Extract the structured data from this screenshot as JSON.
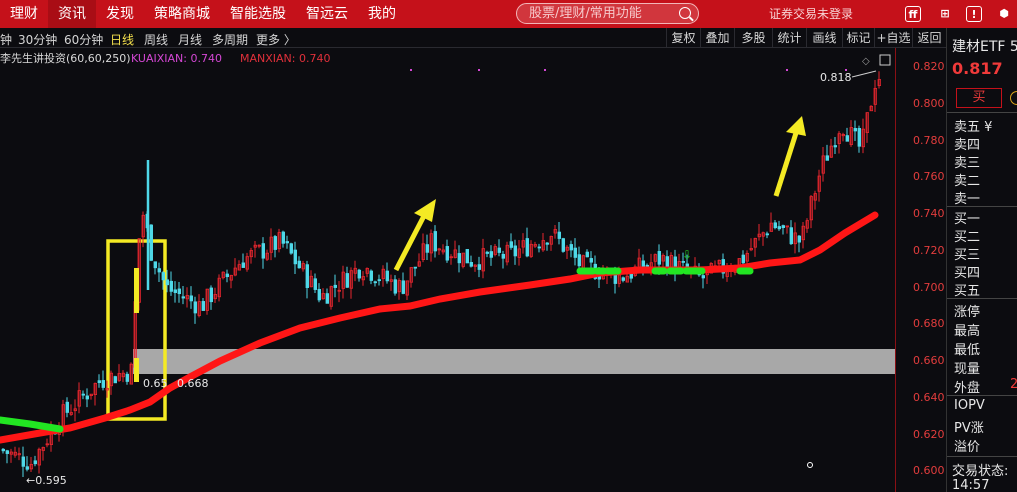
{
  "nav": {
    "items": [
      "理财",
      "资讯",
      "发现",
      "策略商城",
      "智能选股",
      "智远云",
      "我的"
    ],
    "active_index": 1,
    "search_placeholder": "股票/理财/常用功能",
    "login_text": "证券交易未登录"
  },
  "toolbar": {
    "timeframes": [
      "钟",
      "30分钟",
      "60分钟",
      "日线",
      "周线",
      "月线",
      "多周期",
      "更多 〉"
    ],
    "active_timeframe": "日线",
    "buttons": [
      "复权",
      "叠加",
      "多股",
      "统计",
      "画线",
      "标记",
      "+自选",
      "返回"
    ]
  },
  "indicator": {
    "name": "李先生讲投资(60,60,250)",
    "kuaixian": "KUAIXIAN: 0.740",
    "manxian": "MANXIAN: 0.740"
  },
  "axis": {
    "ticks": [
      "0.820",
      "0.800",
      "0.780",
      "0.760",
      "0.740",
      "0.720",
      "0.700",
      "0.680",
      "0.660",
      "0.640",
      "0.620",
      "0.600"
    ]
  },
  "annotations": {
    "low": "0.595",
    "mid_a": "0.65",
    "mid_b": "0.668",
    "high": "0.818"
  },
  "side": {
    "title": "建材ETF 5",
    "price": "0.817",
    "buy_button": "买",
    "sell_rows": [
      "卖五 ¥",
      "卖四",
      "卖三",
      "卖二",
      "卖一"
    ],
    "buy_rows": [
      "买一",
      "买二",
      "买三",
      "买四",
      "买五"
    ],
    "stats": [
      "涨停",
      "最高",
      "最低",
      "现量",
      "外盘"
    ],
    "outer_value": "2",
    "etf": [
      "IOPV",
      "PV涨",
      "溢价"
    ],
    "status": "交易状态:",
    "time": "14:57"
  },
  "colors": {
    "up": "#e8262e",
    "down": "#4fd8e8",
    "fast_up": "#ff1a1a",
    "fast_down": "#22e622",
    "nav": "#c5111a"
  }
}
